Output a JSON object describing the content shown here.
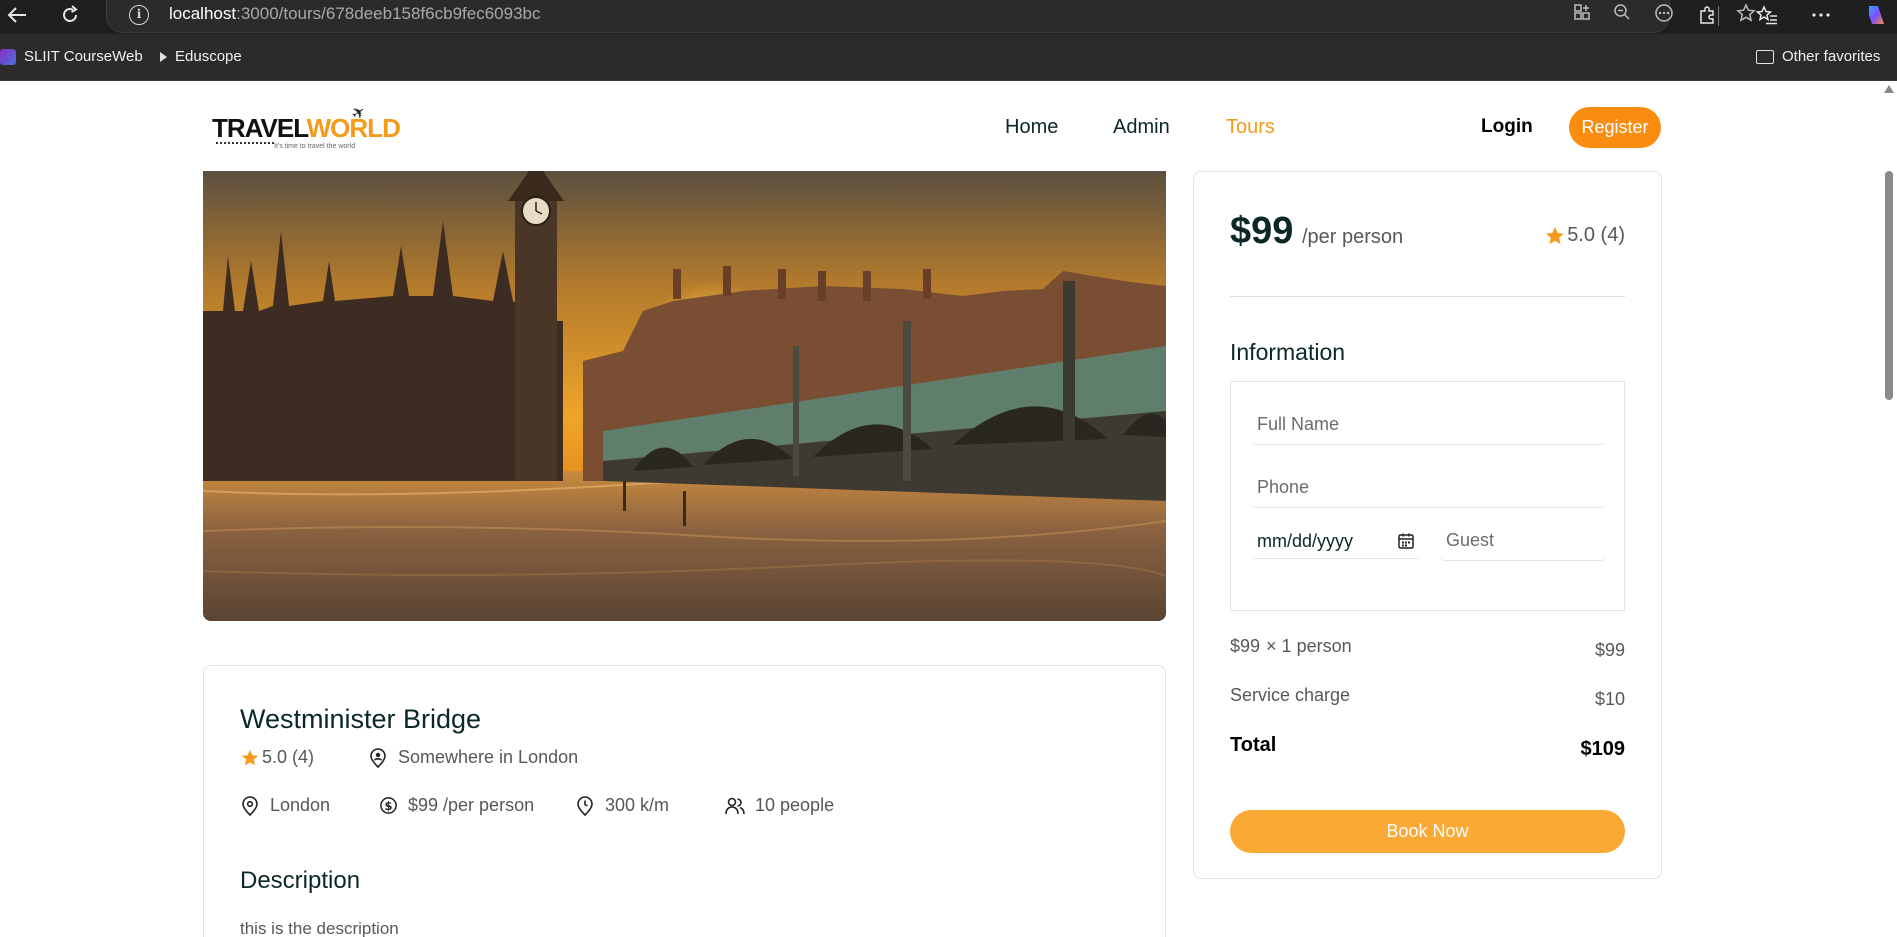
{
  "browser": {
    "url_host": "localhost",
    "url_rest": ":3000/tours/678deeb158f6cb9fec6093bc",
    "bookmarks": [
      "SLIIT CourseWeb",
      "Eduscope"
    ],
    "other_favorites": "Other favorites"
  },
  "header": {
    "logo_travel": "TRAVEL",
    "logo_world": "WORLD",
    "logo_tagline": "It's time to travel the world",
    "nav": [
      "Home",
      "Admin",
      "Tours"
    ],
    "active_nav": "Tours",
    "login": "Login",
    "register": "Register"
  },
  "tour": {
    "title": "Westminister Bridge",
    "rating": "5.0 (4)",
    "address": "Somewhere in London",
    "city": "London",
    "price": "$99 /per person",
    "distance": "300 k/m",
    "group_size": "10 people",
    "description_title": "Description",
    "description": "this is the description"
  },
  "booking": {
    "price": "$99",
    "price_unit": "/per person",
    "rating": "5.0 (4)",
    "info_title": "Information",
    "full_name_placeholder": "Full Name",
    "phone_placeholder": "Phone",
    "date_placeholder": "mm/dd/yyyy",
    "guest_placeholder": "Guest",
    "line_label": "$99",
    "line_multiplier": "× 1 person",
    "line_value": "$99",
    "service_label": "Service charge",
    "service_value": "$10",
    "total_label": "Total",
    "total_value": "$109",
    "book_now": "Book Now"
  },
  "colors": {
    "accent": "#fa8c10",
    "heading": "#0b2727",
    "star": "#f69a1b"
  }
}
